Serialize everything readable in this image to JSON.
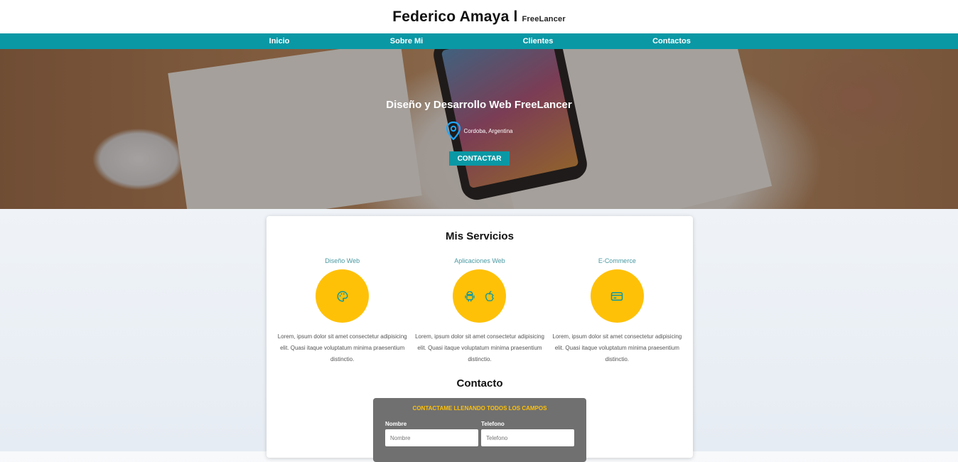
{
  "header": {
    "name": "Federico Amaya",
    "separator": "l",
    "subtitle": "FreeLancer"
  },
  "nav": {
    "items": [
      {
        "label": "Inicio"
      },
      {
        "label": "Sobre Mi"
      },
      {
        "label": "Clientes"
      },
      {
        "label": "Contactos"
      }
    ]
  },
  "hero": {
    "title": "Diseño y Desarrollo Web FreeLancer",
    "location": "Cordoba, Argentina",
    "button": "CONTACTAR"
  },
  "services": {
    "title": "Mis Servicios",
    "items": [
      {
        "title": "Diseño Web",
        "icon": "palette-icon",
        "desc": "Lorem, ipsum dolor sit amet consectetur adipisicing elit. Quasi itaque voluptatum minima praesentium distinctio."
      },
      {
        "title": "Aplicaciones Web",
        "icon": "android-apple-icons",
        "desc": "Lorem, ipsum dolor sit amet consectetur adipisicing elit. Quasi itaque voluptatum minima praesentium distinctio."
      },
      {
        "title": "E-Commerce",
        "icon": "credit-card-icon",
        "desc": "Lorem, ipsum dolor sit amet consectetur adipisicing elit. Quasi itaque voluptatum minima praesentium distinctio."
      }
    ]
  },
  "contact": {
    "title": "Contacto",
    "form_title": "CONTACTAME LLENANDO TODOS LOS CAMPOS",
    "name_label": "Nombre",
    "name_placeholder": "Nombre",
    "phone_label": "Telefono",
    "phone_placeholder": "Telefono"
  },
  "colors": {
    "accent": "#0a98a5",
    "highlight": "#ffc107",
    "form_bg": "#707070"
  }
}
